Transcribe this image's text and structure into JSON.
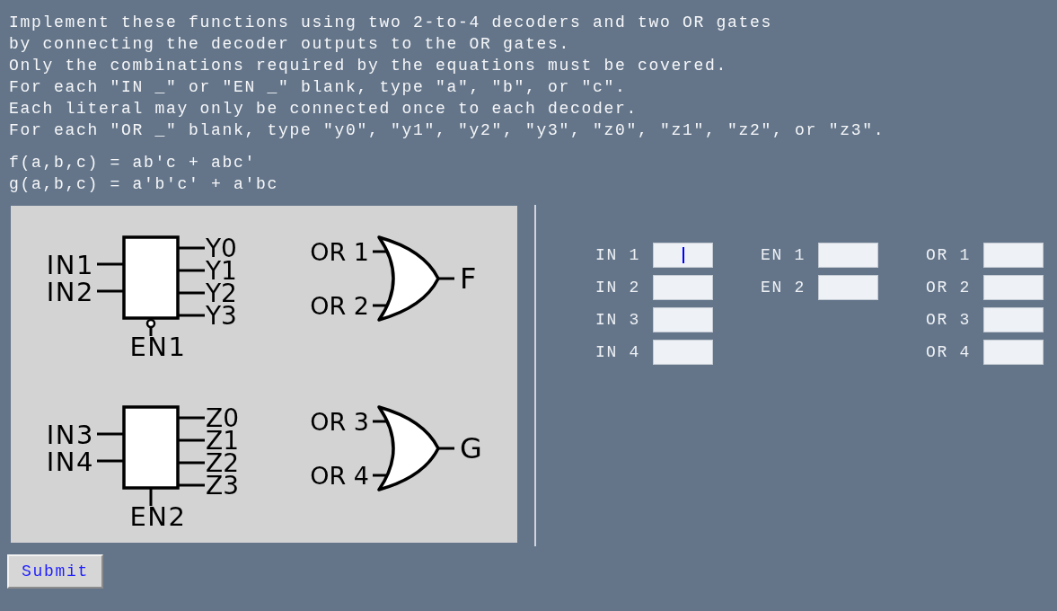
{
  "instructions": [
    "Implement these functions using two 2-to-4 decoders and two OR gates",
    "by connecting the decoder outputs to the OR gates.",
    "Only the combinations required by the equations must be covered.",
    "For each \"IN _\" or \"EN _\" blank, type \"a\", \"b\", or \"c\".",
    "Each literal may only be connected once to each decoder.",
    "For each \"OR _\" blank, type \"y0\", \"y1\", \"y2\", \"y3\", \"z0\", \"z1\", \"z2\", or \"z3\"."
  ],
  "equations": [
    "f(a,b,c) = ab'c + abc'",
    "g(a,b,c) = a'b'c' + a'bc"
  ],
  "diagram": {
    "decoders": [
      {
        "inputs": [
          "IN1",
          "IN2"
        ],
        "outputs": [
          "Y0",
          "Y1",
          "Y2",
          "Y3"
        ],
        "enable": "EN1",
        "enable_active_low": true
      },
      {
        "inputs": [
          "IN3",
          "IN4"
        ],
        "outputs": [
          "Z0",
          "Z1",
          "Z2",
          "Z3"
        ],
        "enable": "EN2",
        "enable_active_low": false
      }
    ],
    "or_gates": [
      {
        "inputs": [
          "OR 1",
          "OR 2"
        ],
        "output": "F"
      },
      {
        "inputs": [
          "OR 3",
          "OR 4"
        ],
        "output": "G"
      }
    ]
  },
  "fields": [
    [
      {
        "label": "IN 1",
        "focused": true
      },
      {
        "label": "IN 2",
        "focused": false
      },
      {
        "label": "IN 3",
        "focused": false
      },
      {
        "label": "IN 4",
        "focused": false
      }
    ],
    [
      {
        "label": "EN 1",
        "focused": false
      },
      {
        "label": "EN 2",
        "focused": false
      }
    ],
    [
      {
        "label": "OR 1",
        "focused": false
      },
      {
        "label": "OR 2",
        "focused": false
      },
      {
        "label": "OR 3",
        "focused": false
      },
      {
        "label": "OR 4",
        "focused": false
      }
    ]
  ],
  "submit": "Submit"
}
